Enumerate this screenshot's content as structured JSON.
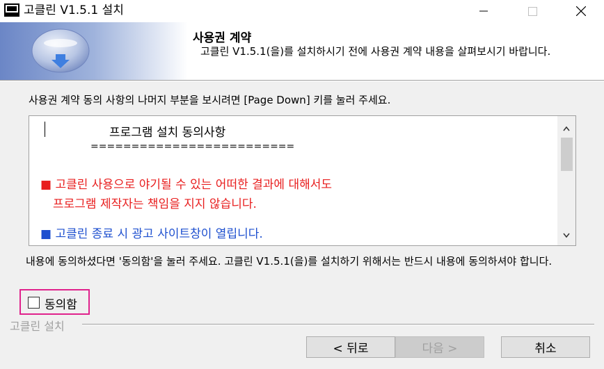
{
  "window": {
    "title": "고클린 V1.5.1 설치",
    "controls": {
      "minimize": "—",
      "maximize": "☐",
      "close": "✕"
    }
  },
  "header": {
    "title": "사용권 계약",
    "description": "고클린 V1.5.1(을)를 설치하시기 전에 사용권 계약 내용을 살펴보시기 바랍니다."
  },
  "instruction": "사용권 계약 동의 사항의 나머지 부분을 보시려면 [Page Down] 키를 눌러 주세요.",
  "license": {
    "title": "프로그램 설치 동의사항",
    "rule": "=========================",
    "red_line1": "■ 고클린 사용으로 야기될 수 있는 어떠한 결과에 대해서도",
    "red_line2": "프로그램 제작자는 책임을 지지 않습니다.",
    "blue_line1": "■ 고클린 종료 시 광고 사이트창이 열립니다.",
    "colors": {
      "red": "#e81e1e",
      "blue": "#1d4fcf"
    }
  },
  "agree_desc": "내용에 동의하셨다면 '동의함'을 눌러 주세요. 고클린 V1.5.1(을)를 설치하기 위해서는 반드시 내용에 동의하셔야 합니다.",
  "checkbox": {
    "label": "동의함",
    "checked": false
  },
  "footer": {
    "group_label": "고클린 설치"
  },
  "buttons": {
    "back": "< 뒤로",
    "next": "다음 >",
    "cancel": "취소"
  }
}
